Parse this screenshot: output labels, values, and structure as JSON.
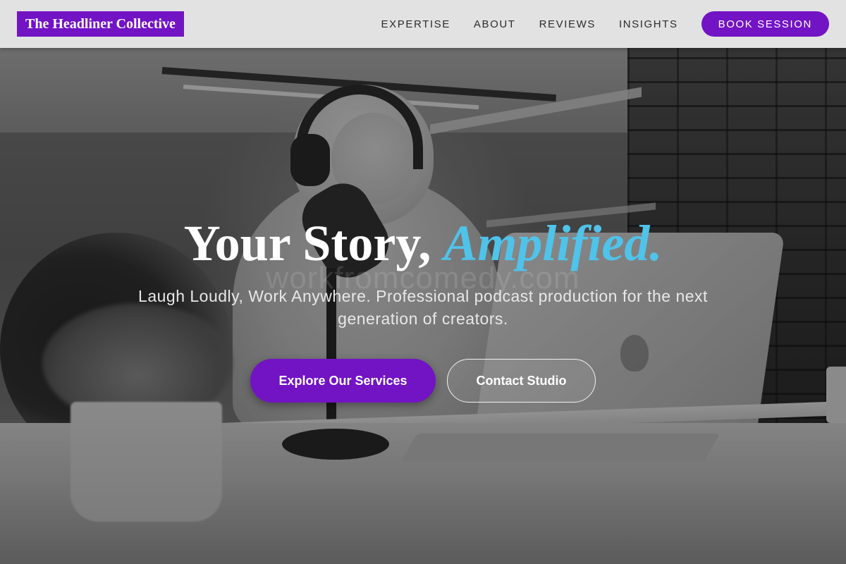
{
  "header": {
    "brand": "The Headliner Collective",
    "nav": [
      {
        "label": "EXPERTISE"
      },
      {
        "label": "ABOUT"
      },
      {
        "label": "REVIEWS"
      },
      {
        "label": "INSIGHTS"
      }
    ],
    "cta_label": "BOOK SESSION"
  },
  "hero": {
    "headline_main": "Your Story, ",
    "headline_accent": "Amplified.",
    "subtitle": "Laugh Loudly, Work Anywhere. Professional podcast production for the next generation of creators.",
    "watermark": "workfromcomedy.com",
    "primary_button": "Explore Our Services",
    "secondary_button": "Contact Studio",
    "background_image": "grayscale photo of a smiling woman wearing headphones speaking into a podcast microphone at a desk with a laptop, plant and brick wall"
  },
  "colors": {
    "accent_purple": "#7213c4",
    "accent_blue": "#4fc3ea",
    "header_bg": "#e8e8e8"
  }
}
